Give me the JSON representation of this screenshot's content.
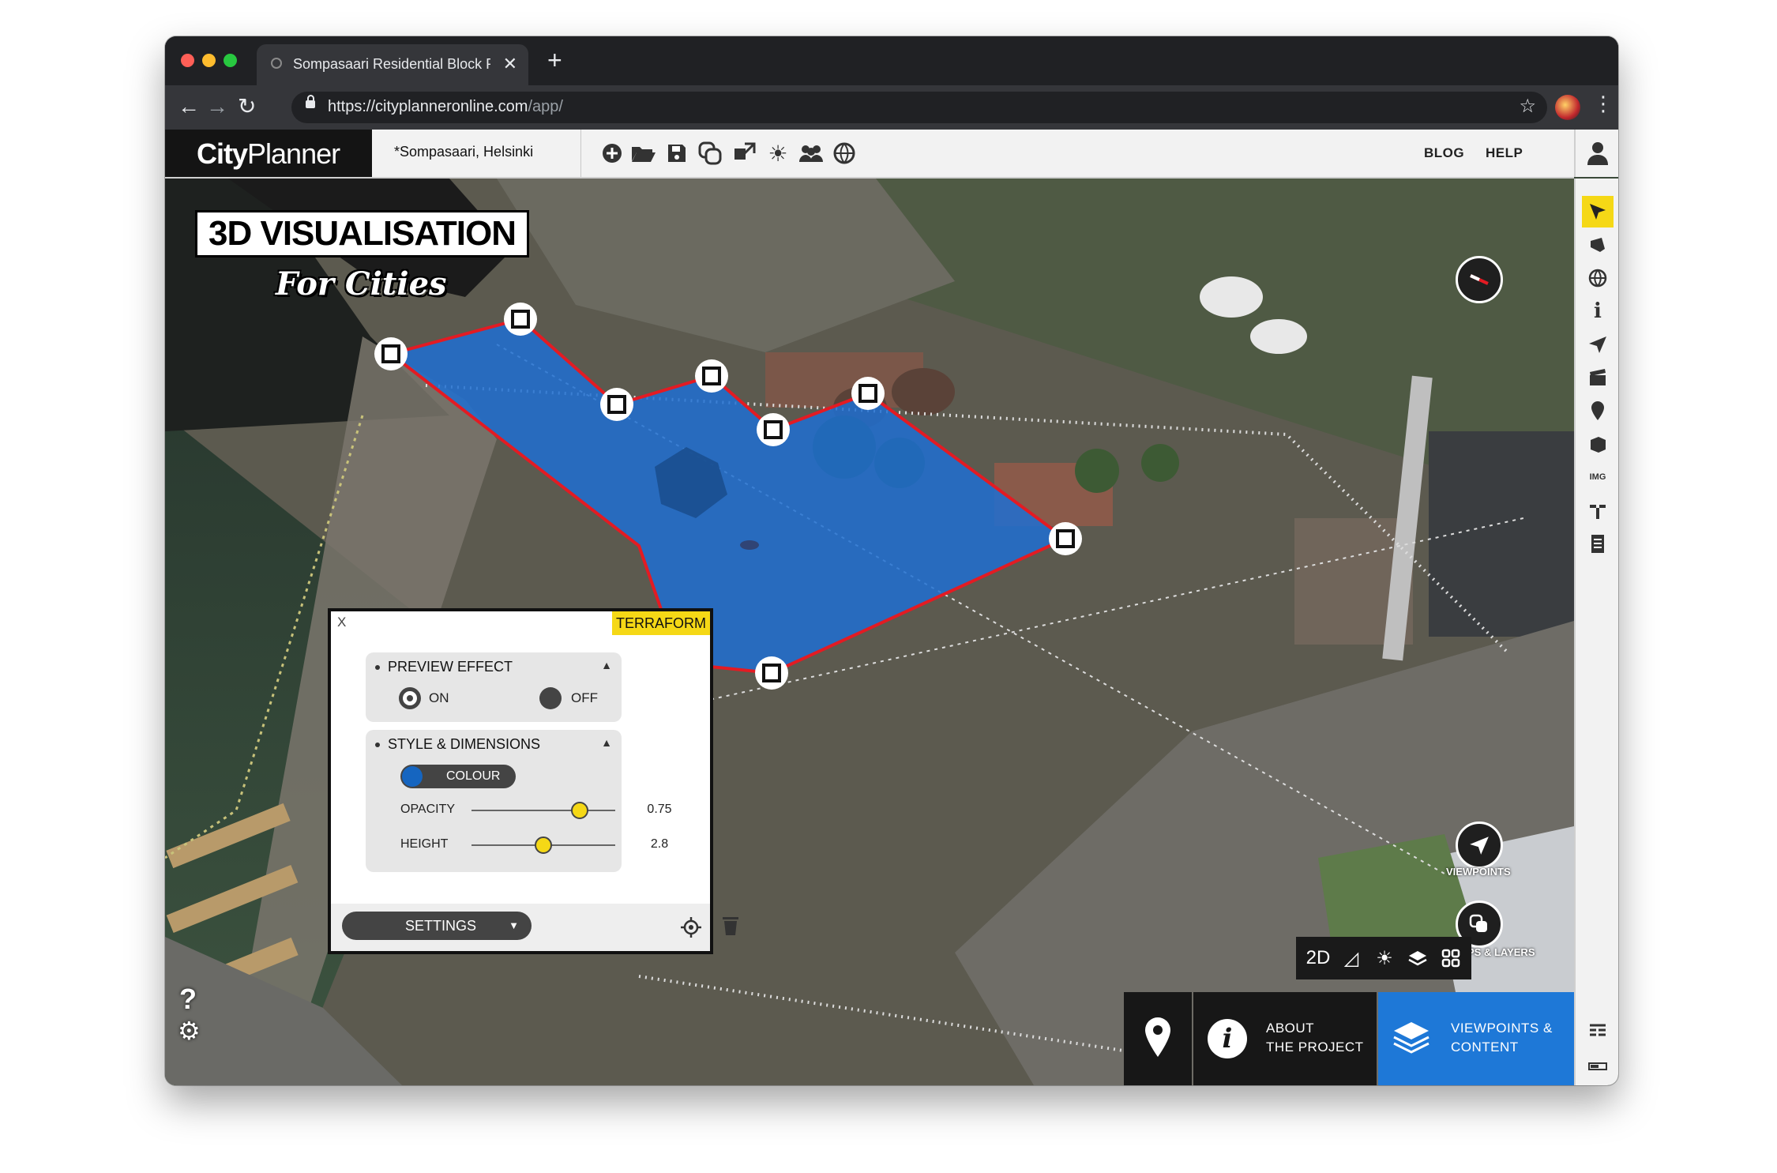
{
  "browser": {
    "tab_title": "Sompasaari Residential Block P",
    "url_host": "https://cityplanneronline.com",
    "url_path": "/app/",
    "new_tab": "+",
    "tab_close": "✕"
  },
  "app": {
    "logo_light": "City",
    "logo_bold": "Planner",
    "project_name": "*Sompasaari, Helsinki",
    "header_links": {
      "blog": "BLOG",
      "help": "HELP"
    },
    "header_tools": [
      "add-icon",
      "open-folder-icon",
      "save-icon",
      "copy-icon",
      "transform-icon",
      "sun-icon",
      "users-icon",
      "globe-icon"
    ]
  },
  "branding": {
    "title": "3D VISUALISATION",
    "subtitle": "For Cities"
  },
  "panel": {
    "close": "X",
    "tag": "TERRAFORM",
    "preview_title": "PREVIEW EFFECT",
    "on_label": "ON",
    "off_label": "OFF",
    "preview_on": true,
    "style_title": "STYLE & DIMENSIONS",
    "colour_label": "COLOUR",
    "colour": "#1565c0",
    "opacity_label": "OPACITY",
    "opacity_value": "0.75",
    "opacity_fraction": 0.75,
    "height_label": "HEIGHT",
    "height_value": "2.8",
    "height_fraction": 0.5,
    "settings_label": "SETTINGS"
  },
  "map_controls": {
    "viewpoints": "VIEWPOINTS",
    "groups_layers": "GROUPS & LAYERS",
    "mode_2d": "2D",
    "help": "?"
  },
  "bottom_bar": {
    "about": [
      "ABOUT",
      "THE PROJECT"
    ],
    "viewpoints_content": [
      "VIEWPOINTS &",
      "CONTENT"
    ],
    "about_bg": "#171717",
    "viewpoints_bg": "#1e78d7"
  },
  "right_toolbar": [
    "cursor-icon",
    "draw-icon",
    "globe-icon",
    "info-icon",
    "send-icon",
    "clapper-icon",
    "pin-icon",
    "cube-icon",
    "image-icon",
    "tree-icon",
    "notes-icon"
  ],
  "colors": {
    "accent_yellow": "#f5d816",
    "terraform_fill": "#1e6fd1",
    "terraform_edge": "#e31b23"
  }
}
